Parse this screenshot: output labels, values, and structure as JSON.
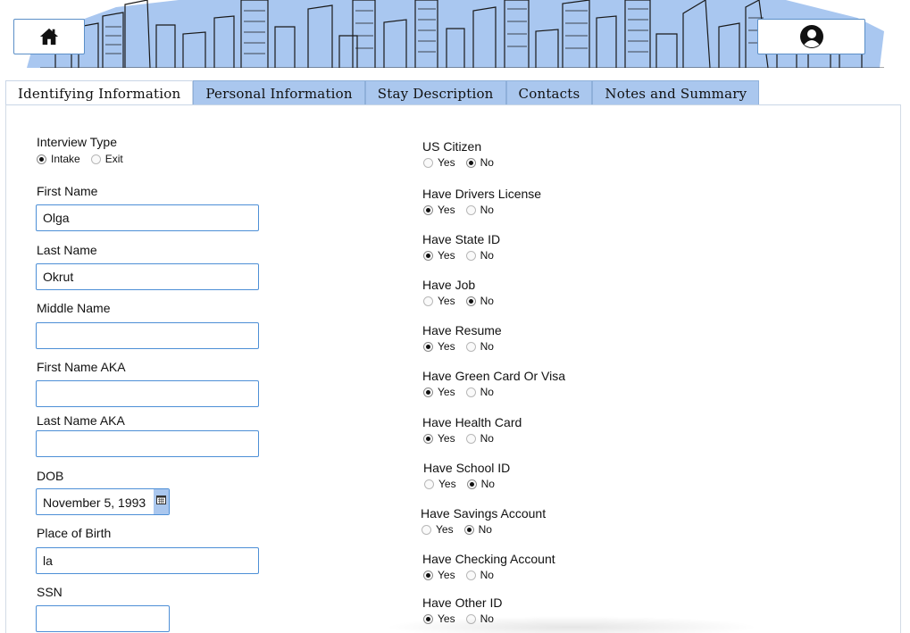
{
  "nav": {
    "tabs": [
      {
        "label": "Identifying Information",
        "active": true
      },
      {
        "label": "Personal Information",
        "active": false
      },
      {
        "label": "Stay Description",
        "active": false
      },
      {
        "label": "Contacts",
        "active": false
      },
      {
        "label": "Notes and Summary",
        "active": false
      }
    ]
  },
  "icons": {
    "home": "home-icon",
    "user": "user-avatar-icon",
    "calendar": "calendar-icon"
  },
  "colors": {
    "accent_border": "#4d8fd6",
    "tab_bg": "#aac7ee"
  },
  "interview_type": {
    "label": "Interview Type",
    "options": [
      "Intake",
      "Exit"
    ],
    "selected": "Intake"
  },
  "fields": {
    "first_name": {
      "label": "First Name",
      "value": "Olga"
    },
    "last_name": {
      "label": "Last Name",
      "value": "Okrut"
    },
    "middle_name": {
      "label": "Middle Name",
      "value": ""
    },
    "first_name_aka": {
      "label": "First Name AKA",
      "value": ""
    },
    "last_name_aka": {
      "label": "Last Name AKA",
      "value": ""
    },
    "dob": {
      "label": "DOB",
      "value": "November 5, 1993"
    },
    "place_of_birth": {
      "label": "Place of Birth",
      "value": "la"
    },
    "ssn": {
      "label": "SSN",
      "value": ""
    }
  },
  "yes_no": {
    "yes": "Yes",
    "no": "No",
    "items": [
      {
        "label": "US Citizen",
        "selected": "No"
      },
      {
        "label": "Have Drivers License",
        "selected": "Yes"
      },
      {
        "label": "Have State ID",
        "selected": "Yes"
      },
      {
        "label": "Have Job",
        "selected": "No"
      },
      {
        "label": "Have Resume",
        "selected": "Yes"
      },
      {
        "label": "Have Green Card Or Visa",
        "selected": "Yes"
      },
      {
        "label": "Have Health Card",
        "selected": "Yes"
      },
      {
        "label": "Have School ID",
        "selected": "No"
      },
      {
        "label": "Have Savings Account",
        "selected": "No"
      },
      {
        "label": "Have Checking Account",
        "selected": "Yes"
      },
      {
        "label": "Have Other ID",
        "selected": "Yes"
      }
    ]
  }
}
